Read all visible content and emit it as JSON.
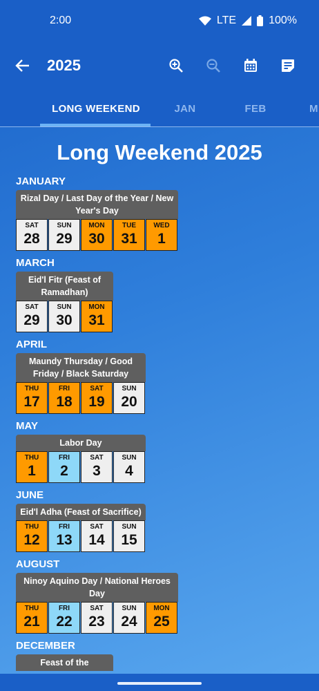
{
  "status": {
    "time": "2:00",
    "network": "LTE",
    "battery": "100%"
  },
  "toolbar": {
    "title": "2025"
  },
  "tabs": [
    "LONG WEEKEND",
    "JAN",
    "FEB",
    "M"
  ],
  "heading": "Long Weekend 2025",
  "months": [
    {
      "name": "JANUARY",
      "holiday": "Rizal Day / Last Day of the Year / New Year's Day",
      "days": [
        {
          "dow": "SAT",
          "num": "28",
          "kind": "weekend"
        },
        {
          "dow": "SUN",
          "num": "29",
          "kind": "weekend"
        },
        {
          "dow": "MON",
          "num": "30",
          "kind": "holiday"
        },
        {
          "dow": "TUE",
          "num": "31",
          "kind": "holiday"
        },
        {
          "dow": "WED",
          "num": "1",
          "kind": "holiday"
        }
      ]
    },
    {
      "name": "MARCH",
      "holiday": "Eid'l Fitr (Feast of Ramadhan)",
      "days": [
        {
          "dow": "SAT",
          "num": "29",
          "kind": "weekend"
        },
        {
          "dow": "SUN",
          "num": "30",
          "kind": "weekend"
        },
        {
          "dow": "MON",
          "num": "31",
          "kind": "holiday"
        }
      ]
    },
    {
      "name": "APRIL",
      "holiday": "Maundy Thursday / Good Friday / Black Saturday",
      "days": [
        {
          "dow": "THU",
          "num": "17",
          "kind": "holiday"
        },
        {
          "dow": "FRI",
          "num": "18",
          "kind": "holiday"
        },
        {
          "dow": "SAT",
          "num": "19",
          "kind": "holiday"
        },
        {
          "dow": "SUN",
          "num": "20",
          "kind": "weekend"
        }
      ]
    },
    {
      "name": "MAY",
      "holiday": "Labor Day",
      "days": [
        {
          "dow": "THU",
          "num": "1",
          "kind": "holiday"
        },
        {
          "dow": "FRI",
          "num": "2",
          "kind": "leave"
        },
        {
          "dow": "SAT",
          "num": "3",
          "kind": "weekend"
        },
        {
          "dow": "SUN",
          "num": "4",
          "kind": "weekend"
        }
      ]
    },
    {
      "name": "JUNE",
      "holiday": "Eid'l Adha (Feast of Sacrifice)",
      "days": [
        {
          "dow": "THU",
          "num": "12",
          "kind": "holiday"
        },
        {
          "dow": "FRI",
          "num": "13",
          "kind": "leave"
        },
        {
          "dow": "SAT",
          "num": "14",
          "kind": "weekend"
        },
        {
          "dow": "SUN",
          "num": "15",
          "kind": "weekend"
        }
      ]
    },
    {
      "name": "AUGUST",
      "holiday": "Ninoy Aquino Day / National Heroes Day",
      "days": [
        {
          "dow": "THU",
          "num": "21",
          "kind": "holiday"
        },
        {
          "dow": "FRI",
          "num": "22",
          "kind": "leave"
        },
        {
          "dow": "SAT",
          "num": "23",
          "kind": "weekend"
        },
        {
          "dow": "SUN",
          "num": "24",
          "kind": "weekend"
        },
        {
          "dow": "MON",
          "num": "25",
          "kind": "holiday"
        }
      ]
    },
    {
      "name": "DECEMBER",
      "holiday": "Feast of the",
      "days": []
    }
  ]
}
